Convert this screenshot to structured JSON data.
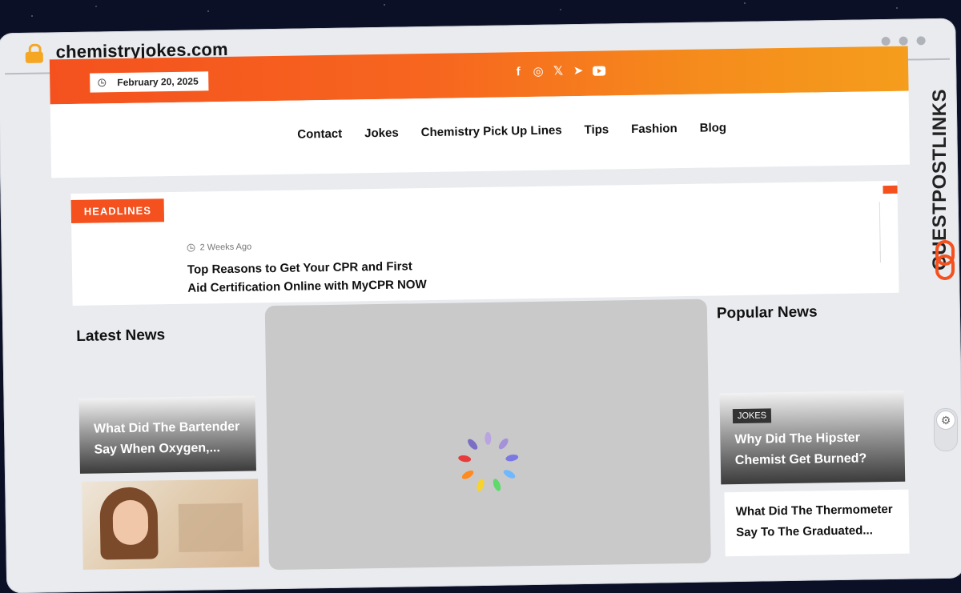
{
  "browser": {
    "url": "chemistryjokes.com"
  },
  "topbar": {
    "date": "February 20, 2025",
    "social_icons": [
      "facebook-icon",
      "instagram-icon",
      "x-icon",
      "telegram-icon",
      "youtube-icon"
    ]
  },
  "nav": {
    "items": [
      "Contact",
      "Jokes",
      "Chemistry Pick Up Lines",
      "Tips",
      "Fashion",
      "Blog"
    ]
  },
  "headlines": {
    "label": "HEADLINES",
    "items": [
      {
        "meta": "2 Weeks Ago",
        "title": "Top Reasons to Get Your CPR and First Aid Certification Online with MyCPR NOW"
      }
    ]
  },
  "latest": {
    "heading": "Latest News",
    "cards": [
      {
        "title": "What Did The Bartender Say When Oxygen,..."
      }
    ]
  },
  "popular": {
    "heading": "Popular News",
    "cards": [
      {
        "tag": "JOKES",
        "title": "Why Did The Hipster Chemist Get Burned?"
      },
      {
        "title": "What Did The Thermometer Say To The Graduated..."
      }
    ]
  },
  "sidebar": {
    "brand": "GUESTPOSTLINKS"
  },
  "colors": {
    "accent": "#f4511e",
    "gradient_end": "#f59d1c",
    "page_bg": "#e9ebef",
    "spinner": [
      "#b9a6e0",
      "#a591d8",
      "#7b78e3",
      "#6fb8ff",
      "#5fd86c",
      "#f6d32d",
      "#ff8a1d",
      "#e83b3b",
      "#7a6fc4"
    ]
  }
}
